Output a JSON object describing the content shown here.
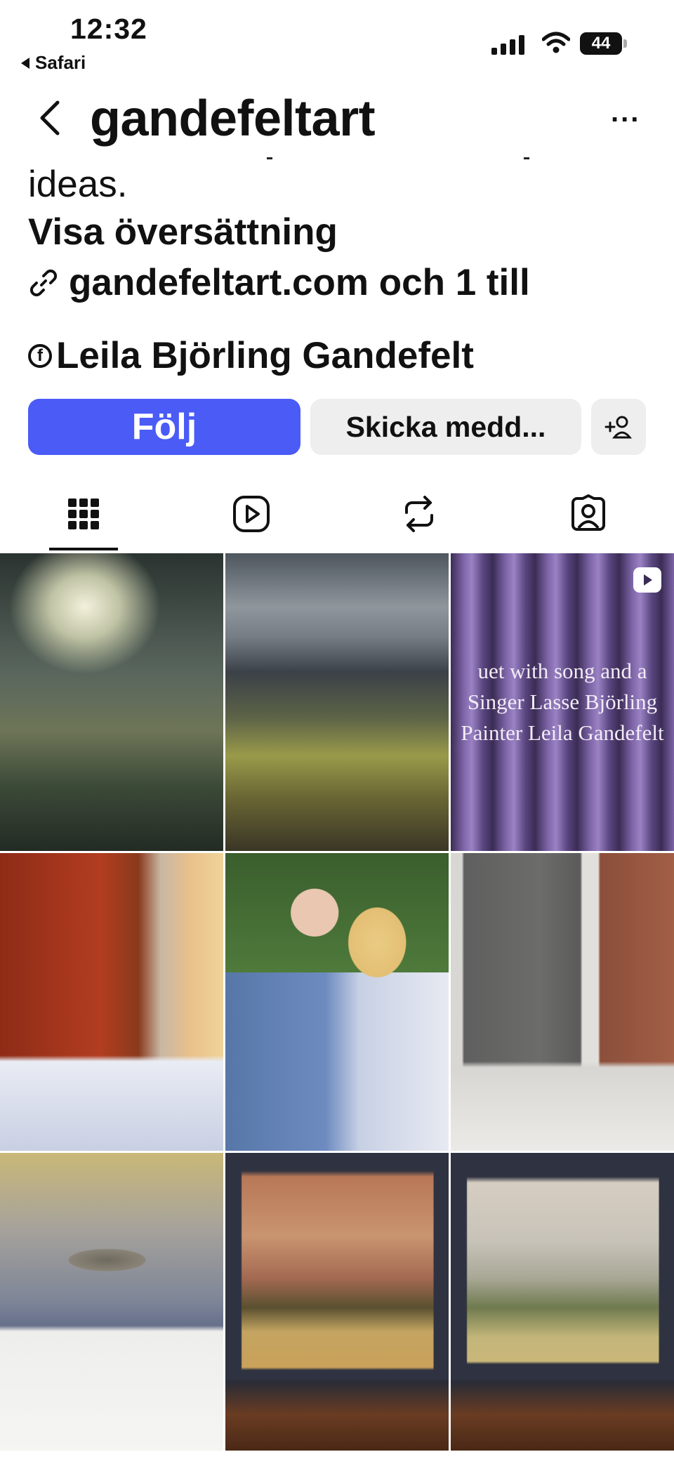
{
  "status_bar": {
    "time": "12:32",
    "back_app": "Safari",
    "battery": "44"
  },
  "header": {
    "username": "gandefeltart",
    "more_label": "..."
  },
  "bio": {
    "text_fragment": "ideas.",
    "translate_label": "Visa översättning",
    "link_text": "gandefeltart.com och 1 till",
    "facebook_name": "Leila Björling Gandefelt"
  },
  "actions": {
    "follow_label": "Följ",
    "message_label": "Skicka medd..."
  },
  "tabs": [
    {
      "name": "grid",
      "icon": "grid-icon",
      "active": true
    },
    {
      "name": "reels",
      "icon": "reels-icon",
      "active": false
    },
    {
      "name": "reposts",
      "icon": "repost-icon",
      "active": false
    },
    {
      "name": "tagged",
      "icon": "tagged-icon",
      "active": false
    }
  ],
  "grid_posts": [
    {
      "subject": "misty landscape painting, glowing sky over hills"
    },
    {
      "subject": "dark stormy landscape painting, yellow field"
    },
    {
      "subject": "purple curtain video",
      "is_reel": true,
      "overlay_lines": [
        "uet with song and a",
        "Singer Lasse Björling",
        "Painter Leila Gandefelt"
      ]
    },
    {
      "subject": "red barn in snow at sunset"
    },
    {
      "subject": "couple portrait outdoors"
    },
    {
      "subject": "grey abstract painting in modern interior"
    },
    {
      "subject": "still life bowl painting above kitchen shelf"
    },
    {
      "subject": "warm sunset landscape painting on dark wall"
    },
    {
      "subject": "soft green landscape painting on dark wall"
    }
  ],
  "colors": {
    "follow_button": "#4a5bf6",
    "secondary_button": "#eeeeef",
    "text": "#111111"
  }
}
